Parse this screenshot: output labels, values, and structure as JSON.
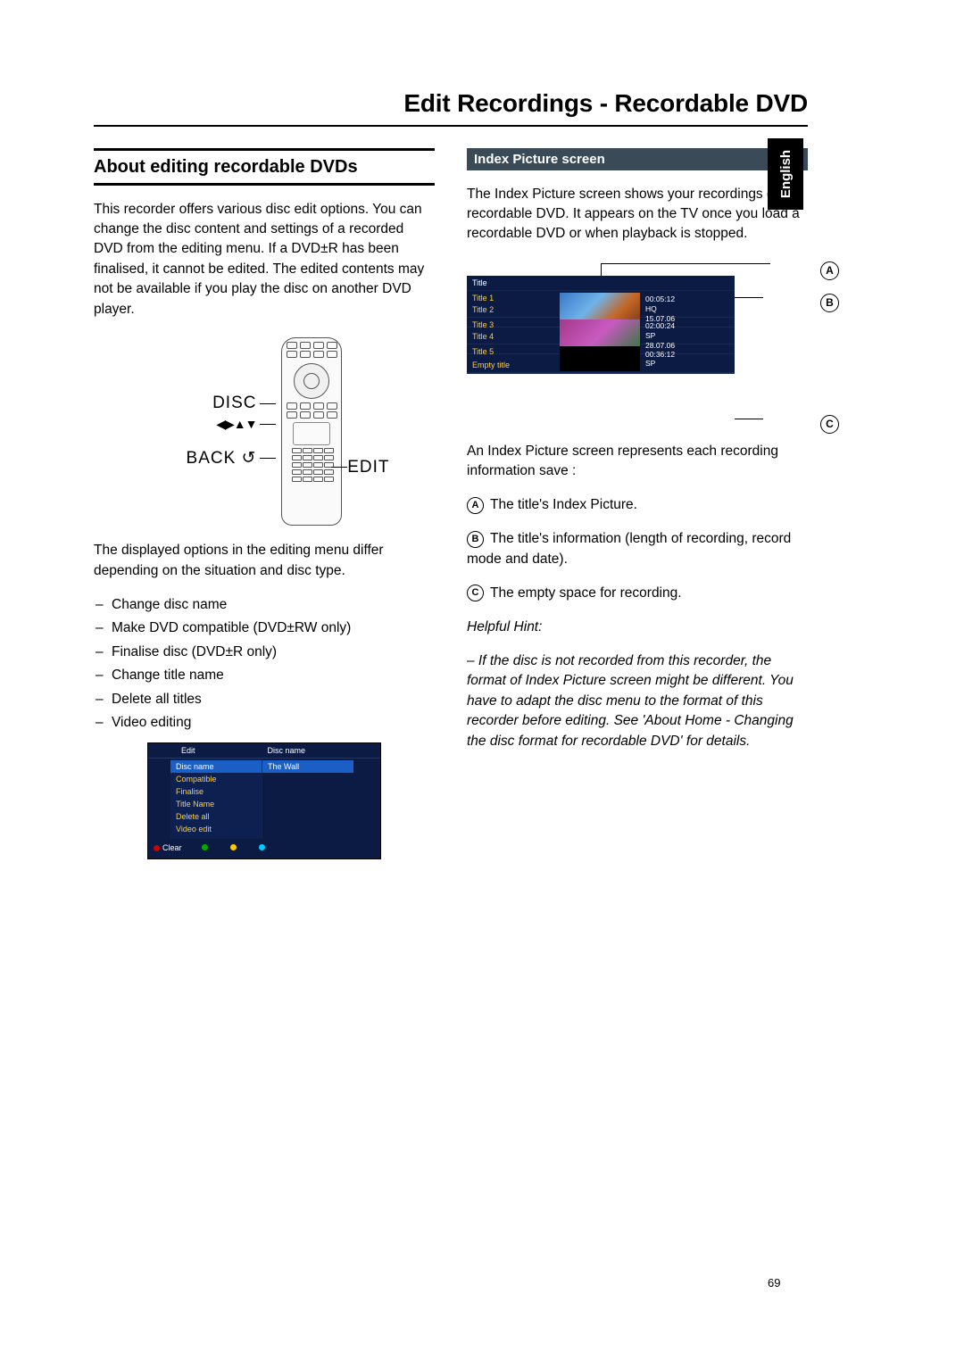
{
  "page": {
    "title": "Edit Recordings - Recordable DVD",
    "language_tab": "English",
    "number": "69"
  },
  "left": {
    "heading": "About editing recordable DVDs",
    "intro": "This recorder offers various disc edit options. You can change the disc content and settings of a recorded DVD from the editing menu. If a DVD±R has been finalised, it cannot be edited. The edited contents may not be available if you play the disc on another DVD player.",
    "remote_labels": {
      "disc": "DISC",
      "arrows": "◀▶▲▼",
      "back": "BACK ",
      "back_icon": "↺",
      "edit": "EDIT"
    },
    "after_remote": "The displayed options in the editing menu differ depending on the situation and disc type.",
    "bullets": [
      "Change disc name",
      "Make DVD compatible (DVD±RW only)",
      "Finalise disc (DVD±R only)",
      "Change title name",
      "Delete all titles",
      "Video editing"
    ],
    "edit_menu": {
      "col1_header": "Edit",
      "col2_header": "Disc name",
      "items": [
        "Disc name",
        "Compatible",
        "Finalise",
        "Title Name",
        "Delete all",
        "Video edit"
      ],
      "value": "The Wall",
      "footer_clear": "Clear"
    }
  },
  "right": {
    "subheading": "Index Picture screen",
    "intro": "The Index Picture screen shows your recordings on a recordable DVD.  It appears on the TV once you load a recordable DVD or when playback is stopped.",
    "ips": {
      "title_header": "Title",
      "titles": [
        "Title 1",
        "Title 2",
        "Title 3",
        "Title 4",
        "Title 5",
        "Empty title"
      ],
      "infos": [
        {
          "dur": "00:05:12",
          "mode": "HQ",
          "date": "15.07.06"
        },
        {
          "dur": "02:00:24",
          "mode": "SP",
          "date": "28.07.06"
        },
        {
          "dur": "00:36:12",
          "mode": "SP",
          "date": ""
        }
      ],
      "callouts": {
        "A": "A",
        "B": "B",
        "C": "C"
      }
    },
    "after_fig": "An Index Picture screen represents each recording information save :",
    "item_a": "The title's Index Picture.",
    "item_b": "The title's information (length of recording, record mode and date).",
    "item_c": "The empty space for recording.",
    "hint_title": "Helpful Hint:",
    "hint_body": "–  If the disc is not recorded from this recorder, the format of Index Picture screen might be different. You have to adapt the disc menu to the format of this recorder before editing.  See 'About Home - Changing the disc format for recordable DVD' for details."
  }
}
